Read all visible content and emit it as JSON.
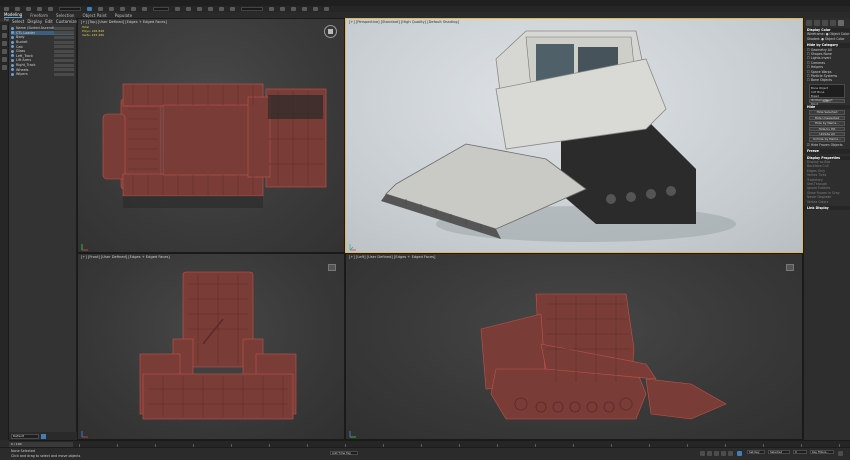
{
  "app": {
    "ribbon_tabs": [
      "Modeling",
      "Freeform",
      "Selection",
      "Object Paint",
      "Populate"
    ],
    "ribbon_sub_label": "Polygon Modeling"
  },
  "explorer": {
    "menu": [
      "Select",
      "Display",
      "Edit",
      "Customize"
    ],
    "items": [
      {
        "label": "Name (Sorted Ascending)",
        "selected": false
      },
      {
        "label": "CTL Loader",
        "selected": true
      },
      {
        "label": "Body",
        "selected": false
      },
      {
        "label": "Bucket",
        "selected": false
      },
      {
        "label": "Cab",
        "selected": false
      },
      {
        "label": "Glass",
        "selected": false
      },
      {
        "label": "Left_Track",
        "selected": false
      },
      {
        "label": "Lift Arms",
        "selected": false
      },
      {
        "label": "Right_Track",
        "selected": false
      },
      {
        "label": "Wheels",
        "selected": false
      },
      {
        "label": "Wipers",
        "selected": false
      }
    ],
    "bottom_field": "Default"
  },
  "viewports": {
    "top": {
      "label": "[+] [Top] [User Defined] [Edges + Edged Faces]",
      "stats": {
        "polys_label": "Polys:",
        "polys_value": "226 848",
        "verts_label": "Verts:",
        "verts_value": "225 486",
        "total_label": "Total"
      }
    },
    "perspective": {
      "label": "[+] [Perspective] [Standard] [High Quality] [Default Shading]"
    },
    "front": {
      "label": "[+] [Front] [User Defined] [Edges + Edged Faces]"
    },
    "left": {
      "label": "[+] [Left] [User Defined] [Edges + Edged Faces]"
    }
  },
  "command_panel": {
    "sections": [
      {
        "type": "hdr",
        "text": "Display Color"
      },
      {
        "type": "row",
        "text": "Wireframe: ● Object Color"
      },
      {
        "type": "row",
        "text": "Shaded: ● Object Color"
      },
      {
        "type": "hdr",
        "text": "Hide by Category"
      },
      {
        "type": "row",
        "text": "☐ Geometry    All"
      },
      {
        "type": "row",
        "text": "☐ Shapes     None"
      },
      {
        "type": "row",
        "text": "☐ Lights     Invert"
      },
      {
        "type": "row",
        "text": "☐ Cameras"
      },
      {
        "type": "row",
        "text": "☐ Helpers"
      },
      {
        "type": "row",
        "text": "☐ Space Warps"
      },
      {
        "type": "row",
        "text": "☐ Particle Systems"
      },
      {
        "type": "row",
        "text": "☐ Bone Objects"
      },
      {
        "type": "list",
        "items": [
          "Bone Object",
          "CAT Bone",
          "Biped",
          "IK Chain Object",
          "Point"
        ]
      },
      {
        "type": "btn",
        "text": "Add..."
      },
      {
        "type": "hdr",
        "text": "Hide"
      },
      {
        "type": "btn",
        "text": "Hide Selected"
      },
      {
        "type": "btn",
        "text": "Hide Unselected"
      },
      {
        "type": "btn",
        "text": "Hide by Name..."
      },
      {
        "type": "btn",
        "text": "Hide by Hit"
      },
      {
        "type": "btn",
        "text": "Unhide All"
      },
      {
        "type": "btn",
        "text": "Unhide by Name..."
      },
      {
        "type": "row",
        "text": "☑ Hide Frozen Objects"
      },
      {
        "type": "hdr",
        "text": "Freeze"
      },
      {
        "type": "hdr",
        "text": "Display Properties"
      },
      {
        "type": "dim",
        "text": "Display as Box"
      },
      {
        "type": "dim",
        "text": "Backface Cull"
      },
      {
        "type": "dim",
        "text": "Edges Only"
      },
      {
        "type": "dim",
        "text": "Vertex Ticks"
      },
      {
        "type": "dim",
        "text": "Trajectory"
      },
      {
        "type": "dim",
        "text": "See-Through"
      },
      {
        "type": "dim",
        "text": "Ignore Extents"
      },
      {
        "type": "dim",
        "text": "Show Frozen in Gray"
      },
      {
        "type": "dim",
        "text": "Never Degrade"
      },
      {
        "type": "dim",
        "text": "Vertex Colors"
      },
      {
        "type": "hdr",
        "text": "Link Display"
      }
    ]
  },
  "status": {
    "line1": "None Selected",
    "line2": "Click and drag to select and move objects",
    "add_time_tag": "Add Time Tag",
    "set_key": "Set Key",
    "key_filters": "Key Filters...",
    "selected": "Selected",
    "frame": "0"
  },
  "timeline": {
    "range_label": "0 / 100"
  },
  "colors": {
    "accent": "#3f7fb5",
    "wire": "#c0544a",
    "selection_border": "#e2b84a",
    "stats": "#e0d040"
  }
}
